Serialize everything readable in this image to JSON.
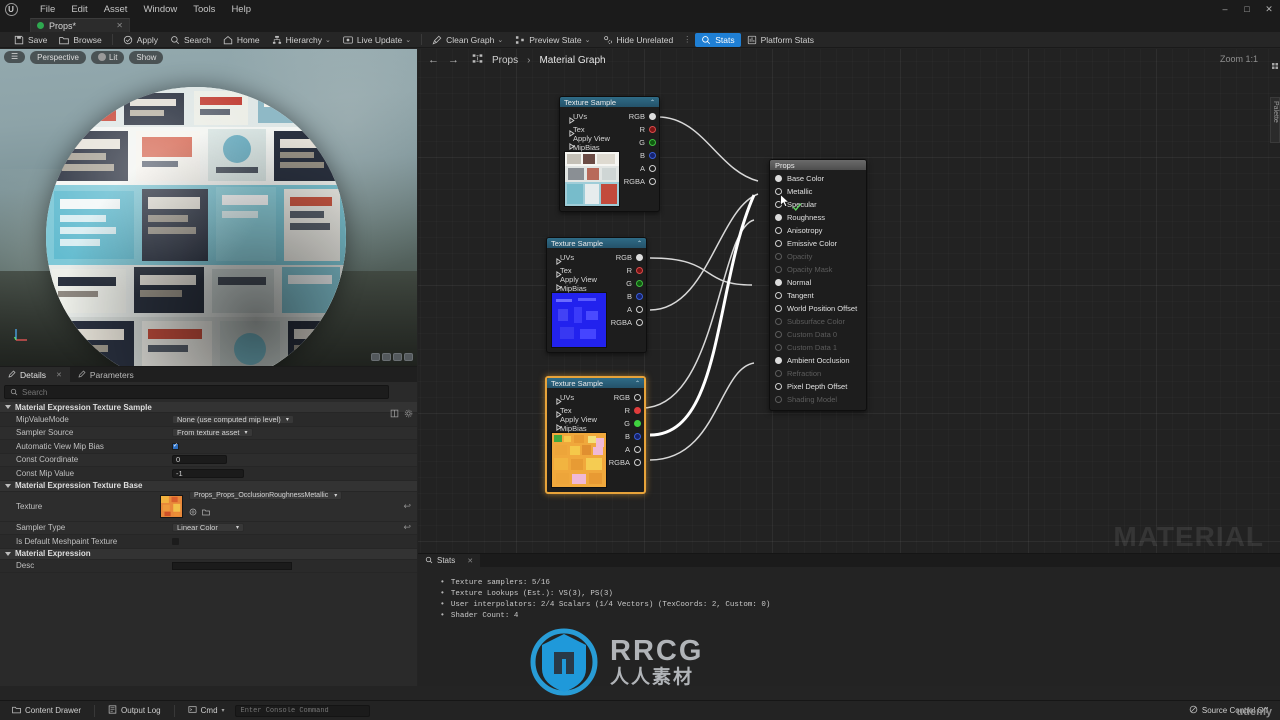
{
  "window": {
    "menu": [
      "File",
      "Edit",
      "Asset",
      "Window",
      "Tools",
      "Help"
    ],
    "controls": {
      "minimize": "–",
      "maximize": "□",
      "close": "✕"
    },
    "logo": "unreal-engine-logo"
  },
  "asset_tab": {
    "label": "Props*",
    "close": "✕"
  },
  "toolbar": {
    "buttons": [
      {
        "label": "Save",
        "icon": "save-icon",
        "dropdown": false,
        "active": false
      },
      {
        "label": "Browse",
        "icon": "browse-icon",
        "dropdown": false,
        "active": false
      },
      {
        "label": "Apply",
        "icon": "apply-icon",
        "dropdown": false,
        "active": false
      },
      {
        "label": "Search",
        "icon": "search-icon",
        "dropdown": false,
        "active": false
      },
      {
        "label": "Home",
        "icon": "home-icon",
        "dropdown": false,
        "active": false
      },
      {
        "label": "Hierarchy",
        "icon": "hierarchy-icon",
        "dropdown": true,
        "active": false
      },
      {
        "label": "Live Update",
        "icon": "live-update-icon",
        "dropdown": true,
        "active": false
      },
      {
        "label": "Clean Graph",
        "icon": "clean-graph-icon",
        "dropdown": true,
        "active": false
      },
      {
        "label": "Preview State",
        "icon": "preview-state-icon",
        "dropdown": true,
        "active": false
      },
      {
        "label": "Hide Unrelated",
        "icon": "hide-unrelated-icon",
        "dropdown": false,
        "active": false
      },
      {
        "label": "Stats",
        "icon": "stats-icon",
        "dropdown": false,
        "active": true
      },
      {
        "label": "Platform Stats",
        "icon": "platform-stats-icon",
        "dropdown": false,
        "active": false
      }
    ],
    "overflow": "⋮",
    "chevron": "⌄"
  },
  "viewport": {
    "pills": [
      "Perspective",
      "Lit",
      "Show"
    ],
    "menu_icon": "viewport-menu-icon",
    "gizmo": "axis-gizmo"
  },
  "details": {
    "tabs": [
      {
        "label": "Details",
        "icon": "details-icon",
        "selected": true,
        "close": "✕"
      },
      {
        "label": "Parameters",
        "icon": "parameters-icon",
        "selected": false
      }
    ],
    "search_placeholder": "Search",
    "search_value": "",
    "sections": [
      {
        "title": "Material Expression Texture Sample",
        "rows": [
          {
            "name": "MipValueMode",
            "type": "combo",
            "value": "None (use computed mip level)"
          },
          {
            "name": "Sampler Source",
            "type": "combo",
            "value": "From texture asset"
          },
          {
            "name": "Automatic View Mip Bias",
            "type": "checkbox",
            "checked": true
          },
          {
            "name": "Const Coordinate",
            "type": "number",
            "value": "0"
          },
          {
            "name": "Const Mip Value",
            "type": "number",
            "value": "-1"
          }
        ]
      },
      {
        "title": "Material Expression Texture Base",
        "rows": [
          {
            "name": "Texture",
            "type": "asset",
            "value": "Props_Props_OcclusionRoughnessMetallic",
            "revert": "↩"
          },
          {
            "name": "Sampler Type",
            "type": "combo",
            "value": "Linear Color",
            "revert": "↩"
          },
          {
            "name": "Is Default Meshpaint Texture",
            "type": "checkbox",
            "checked": false
          }
        ]
      },
      {
        "title": "Material Expression",
        "rows": [
          {
            "name": "Desc",
            "type": "text",
            "value": ""
          }
        ]
      }
    ]
  },
  "graph": {
    "breadcrumb": {
      "back": "←",
      "forward": "→",
      "icon": "graph-icon",
      "root": "Props",
      "sep": "›",
      "current": "Material Graph"
    },
    "zoom_label": "Zoom 1:1",
    "palette_label": "Palette",
    "watermark": "MATERIAL",
    "nodes": [
      {
        "title": "Texture Sample",
        "collapse": "⌃",
        "selected": false,
        "inputs": [
          "UVs",
          "Tex",
          "Apply View MipBias"
        ],
        "outputs": [
          "RGB",
          "R",
          "G",
          "B",
          "A",
          "RGBA"
        ],
        "preview": "photo-collage-texture"
      },
      {
        "title": "Texture Sample",
        "collapse": "⌃",
        "selected": false,
        "inputs": [
          "UVs",
          "Tex",
          "Apply View MipBias"
        ],
        "outputs": [
          "RGB",
          "R",
          "G",
          "B",
          "A",
          "RGBA"
        ],
        "preview": "normal-map-texture"
      },
      {
        "title": "Texture Sample",
        "collapse": "⌃",
        "selected": true,
        "inputs": [
          "UVs",
          "Tex",
          "Apply View MipBias"
        ],
        "outputs": [
          "RGB",
          "R",
          "G",
          "B",
          "A",
          "RGBA"
        ],
        "preview": "orm-texture"
      }
    ],
    "result_node": {
      "title": "Props",
      "pins": [
        {
          "label": "Base Color",
          "connected": true,
          "enabled": true
        },
        {
          "label": "Metallic",
          "connected": false,
          "enabled": true
        },
        {
          "label": "Specular",
          "connected": false,
          "enabled": true
        },
        {
          "label": "Roughness",
          "connected": true,
          "enabled": true
        },
        {
          "label": "Anisotropy",
          "connected": false,
          "enabled": true
        },
        {
          "label": "Emissive Color",
          "connected": false,
          "enabled": true
        },
        {
          "label": "Opacity",
          "connected": false,
          "enabled": false
        },
        {
          "label": "Opacity Mask",
          "connected": false,
          "enabled": false
        },
        {
          "label": "Normal",
          "connected": true,
          "enabled": true
        },
        {
          "label": "Tangent",
          "connected": false,
          "enabled": true
        },
        {
          "label": "World Position Offset",
          "connected": false,
          "enabled": true
        },
        {
          "label": "Subsurface Color",
          "connected": false,
          "enabled": false
        },
        {
          "label": "Custom Data 0",
          "connected": false,
          "enabled": false
        },
        {
          "label": "Custom Data 1",
          "connected": false,
          "enabled": false
        },
        {
          "label": "Ambient Occlusion",
          "connected": true,
          "enabled": true
        },
        {
          "label": "Refraction",
          "connected": false,
          "enabled": false
        },
        {
          "label": "Pixel Depth Offset",
          "connected": false,
          "enabled": true
        },
        {
          "label": "Shading Model",
          "connected": false,
          "enabled": false
        }
      ]
    }
  },
  "stats": {
    "tab": {
      "label": "Stats",
      "icon": "stats-icon",
      "close": "✕"
    },
    "lines": [
      "Texture samplers: 5/16",
      "Texture Lookups (Est.): VS(3), PS(3)",
      "User interpolators: 2/4 Scalars (1/4 Vectors) (TexCoords: 2, Custom: 0)",
      "Shader Count: 4"
    ],
    "bullet": "•"
  },
  "statusbar": {
    "content_drawer": "Content Drawer",
    "output_log": "Output Log",
    "cmd_label": "Cmd",
    "cmd_placeholder": "Enter Console Command",
    "cmd_value": "",
    "source_control": "Source Control Off"
  },
  "overlay": {
    "brand_main": "RRCG",
    "brand_sub": "人人素材",
    "udemy": "udemy"
  },
  "colors": {
    "accent_blue": "#1f7fd4",
    "node_header": "#2f6b86",
    "selected_node": "#e7a33a",
    "panel_bg": "#2a2a2a",
    "graph_bg": "#222222",
    "brand": "#29a3e0"
  }
}
